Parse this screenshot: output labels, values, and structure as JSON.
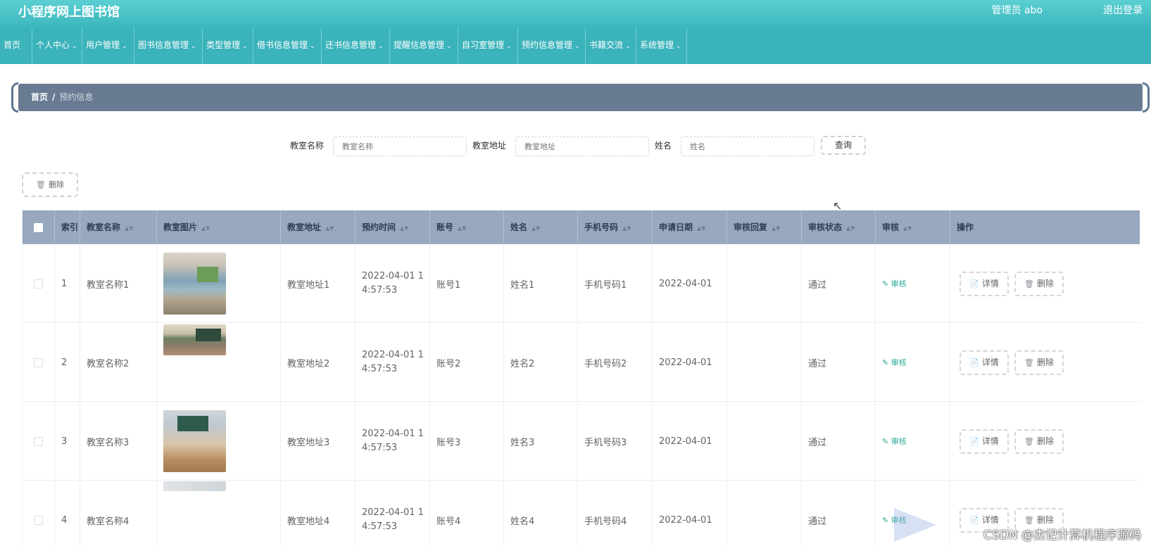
{
  "app": {
    "title": "小程序网上图书馆",
    "admin": "管理员 abo",
    "logout": "退出登录"
  },
  "nav": [
    {
      "label": "首页",
      "dropdown": false
    },
    {
      "label": "个人中心",
      "dropdown": true
    },
    {
      "label": "用户管理",
      "dropdown": true
    },
    {
      "label": "图书信息管理",
      "dropdown": true
    },
    {
      "label": "类型管理",
      "dropdown": true
    },
    {
      "label": "借书信息管理",
      "dropdown": true
    },
    {
      "label": "还书信息管理",
      "dropdown": true
    },
    {
      "label": "提醒信息管理",
      "dropdown": true
    },
    {
      "label": "自习室管理",
      "dropdown": true
    },
    {
      "label": "预约信息管理",
      "dropdown": true
    },
    {
      "label": "书籍交流",
      "dropdown": true
    },
    {
      "label": "系统管理",
      "dropdown": true
    }
  ],
  "breadcrumb": {
    "home": "首页",
    "separator": "/",
    "current": "预约信息"
  },
  "search": {
    "room_name_label": "教室名称",
    "room_name_placeholder": "教室名称",
    "room_addr_label": "教室地址",
    "room_addr_placeholder": "教室地址",
    "name_label": "姓名",
    "name_placeholder": "姓名",
    "query_button": "查询"
  },
  "toolbar": {
    "delete_label": "删除"
  },
  "table": {
    "columns": [
      "索引",
      "教室名称",
      "教室图片",
      "教室地址",
      "预约时间",
      "账号",
      "姓名",
      "手机号码",
      "申请日期",
      "审核回复",
      "审核状态",
      "审核",
      "操作"
    ],
    "audit_label": "审核",
    "detail_label": "详情",
    "delete_label": "删除",
    "rows": [
      {
        "index": "1",
        "room_name": "教室名称1",
        "room_addr": "教室地址1",
        "time_line1": "2022-04-01 1",
        "time_line2": "4:57:53",
        "account": "账号1",
        "name": "姓名1",
        "phone": "手机号码1",
        "apply_date": "2022-04-01",
        "reply": "",
        "status": "通过"
      },
      {
        "index": "2",
        "room_name": "教室名称2",
        "room_addr": "教室地址2",
        "time_line1": "2022-04-01 1",
        "time_line2": "4:57:53",
        "account": "账号2",
        "name": "姓名2",
        "phone": "手机号码2",
        "apply_date": "2022-04-01",
        "reply": "",
        "status": "通过"
      },
      {
        "index": "3",
        "room_name": "教室名称3",
        "room_addr": "教室地址3",
        "time_line1": "2022-04-01 1",
        "time_line2": "4:57:53",
        "account": "账号3",
        "name": "姓名3",
        "phone": "手机号码3",
        "apply_date": "2022-04-01",
        "reply": "",
        "status": "通过"
      },
      {
        "index": "4",
        "room_name": "教室名称4",
        "room_addr": "教室地址4",
        "time_line1": "2022-04-01 1",
        "time_line2": "4:57:53",
        "account": "账号4",
        "name": "姓名4",
        "phone": "手机号码4",
        "apply_date": "2022-04-01",
        "reply": "",
        "status": "通过"
      }
    ]
  },
  "watermark": "CSDN @杰记计算机程序源码",
  "colors": {
    "topbar": "#3bb6bd",
    "nav": "#3bb3ba",
    "breadcrumb": "#687b92",
    "table_header": "#97a8bf",
    "audit": "#2aa897"
  }
}
